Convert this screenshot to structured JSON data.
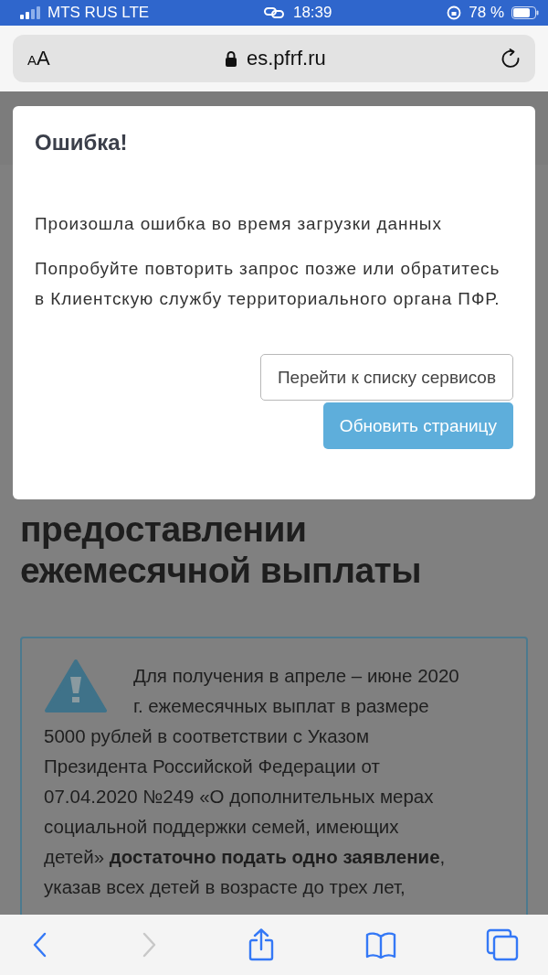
{
  "status_bar": {
    "carrier": "MTS RUS LTE",
    "time": "18:39",
    "battery": "78 %"
  },
  "address_bar": {
    "text_size": "AA",
    "url": "es.pfrf.ru"
  },
  "page": {
    "heading": "предоставлении ежемесячной выплаты",
    "notice_lines": [
      "Для получения в апреле – июне 2020",
      "г. ежемесячных выплат в размере",
      "5000 рублей в соответствии с Указом",
      "Президента Российской Федерации от",
      "07.04.2020 №249 «О дополнительных мерах",
      "социальной поддержки семей, имеющих",
      "детей» **достаточно подать одно заявление**,",
      "указав всех детей в возрасте до трех лет,"
    ]
  },
  "modal": {
    "title": "Ошибка!",
    "messages": [
      "Произошла ошибка во время загрузки данных",
      "Попробуйте повторить запрос позже или обратитесь в Клиентскую службу территориального органа ПФР."
    ],
    "buttons": [
      {
        "label": "Перейти к списку сервисов",
        "kind": "secondary"
      },
      {
        "label": "Обновить страницу",
        "kind": "primary"
      }
    ]
  },
  "toolbar": {
    "back": {
      "disabled": false
    },
    "forward": {
      "disabled": true
    }
  }
}
